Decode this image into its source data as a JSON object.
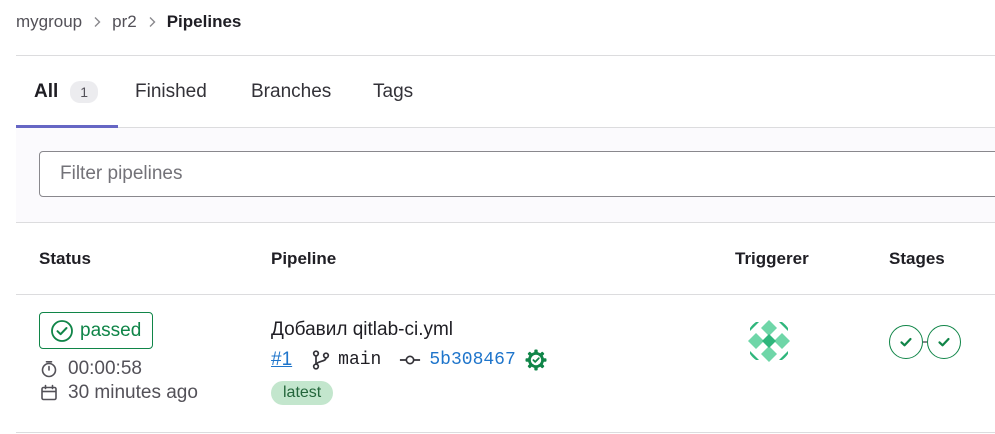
{
  "breadcrumb": {
    "group": "mygroup",
    "project": "pr2",
    "current": "Pipelines"
  },
  "tabs": [
    {
      "label": "All",
      "count": "1"
    },
    {
      "label": "Finished"
    },
    {
      "label": "Branches"
    },
    {
      "label": "Tags"
    }
  ],
  "filter": {
    "placeholder": "Filter pipelines"
  },
  "table": {
    "columns": [
      "Status",
      "Pipeline",
      "Triggerer",
      "Stages"
    ],
    "rows": [
      {
        "status": "passed",
        "duration": "00:00:58",
        "finished": "30 minutes ago",
        "title": "Добавил qitlab-ci.yml",
        "id": "#1",
        "branch": "main",
        "sha": "5b308467",
        "badge": "latest"
      }
    ]
  },
  "colors": {
    "success": "#108548",
    "link": "#1f75cb",
    "tab_accent": "#6666c4",
    "latest_bg": "#c3e6cd"
  },
  "icons": [
    "chevron-right-icon",
    "status-success-icon",
    "timer-icon",
    "calendar-icon",
    "branch-icon",
    "commit-icon",
    "verified-gear-icon",
    "check-icon"
  ]
}
